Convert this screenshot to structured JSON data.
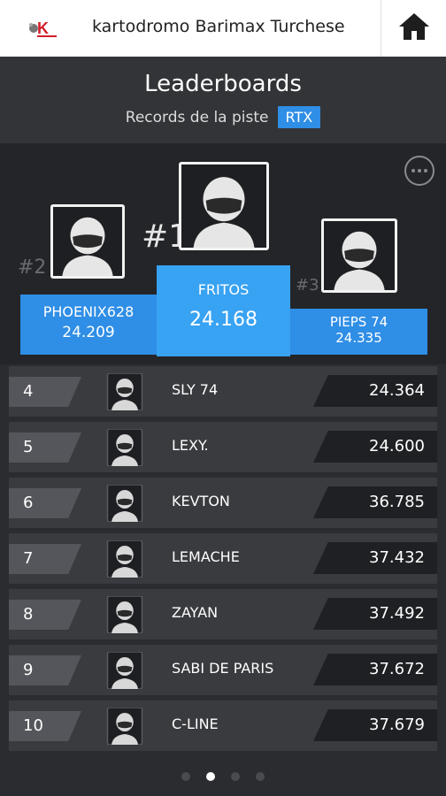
{
  "header": {
    "venue_name": "kartodromo Barimax Turchese",
    "title": "Leaderboards",
    "subtitle": "Records de la piste",
    "category_badge": "RTX"
  },
  "icons": {
    "home": "home-icon",
    "more": "more-icon",
    "avatar": "helmet-avatar-icon",
    "logo": "k-logo"
  },
  "colors": {
    "accent": "#2f8ee6",
    "accent_light": "#38a2f3",
    "background": "#2b2c2f"
  },
  "podium": {
    "first": {
      "rank_mark": "#1",
      "name": "FRITOS",
      "time": "24.168"
    },
    "second": {
      "rank_mark": "#2",
      "name": "PHOENIX628",
      "time": "24.209"
    },
    "third": {
      "rank_mark": "#3",
      "name": "PIEPS 74",
      "time": "24.335"
    }
  },
  "leaderboard": [
    {
      "rank": "4",
      "name": "SLY 74",
      "time": "24.364"
    },
    {
      "rank": "5",
      "name": "LEXY.",
      "time": "24.600"
    },
    {
      "rank": "6",
      "name": "KEVTON",
      "time": "36.785"
    },
    {
      "rank": "7",
      "name": "LEMACHE",
      "time": "37.432"
    },
    {
      "rank": "8",
      "name": "ZAYAN",
      "time": "37.492"
    },
    {
      "rank": "9",
      "name": "SABI DE PARIS",
      "time": "37.672"
    },
    {
      "rank": "10",
      "name": "C-LINE",
      "time": "37.679"
    }
  ],
  "pagination": {
    "pages": 4,
    "active_page": 2
  }
}
